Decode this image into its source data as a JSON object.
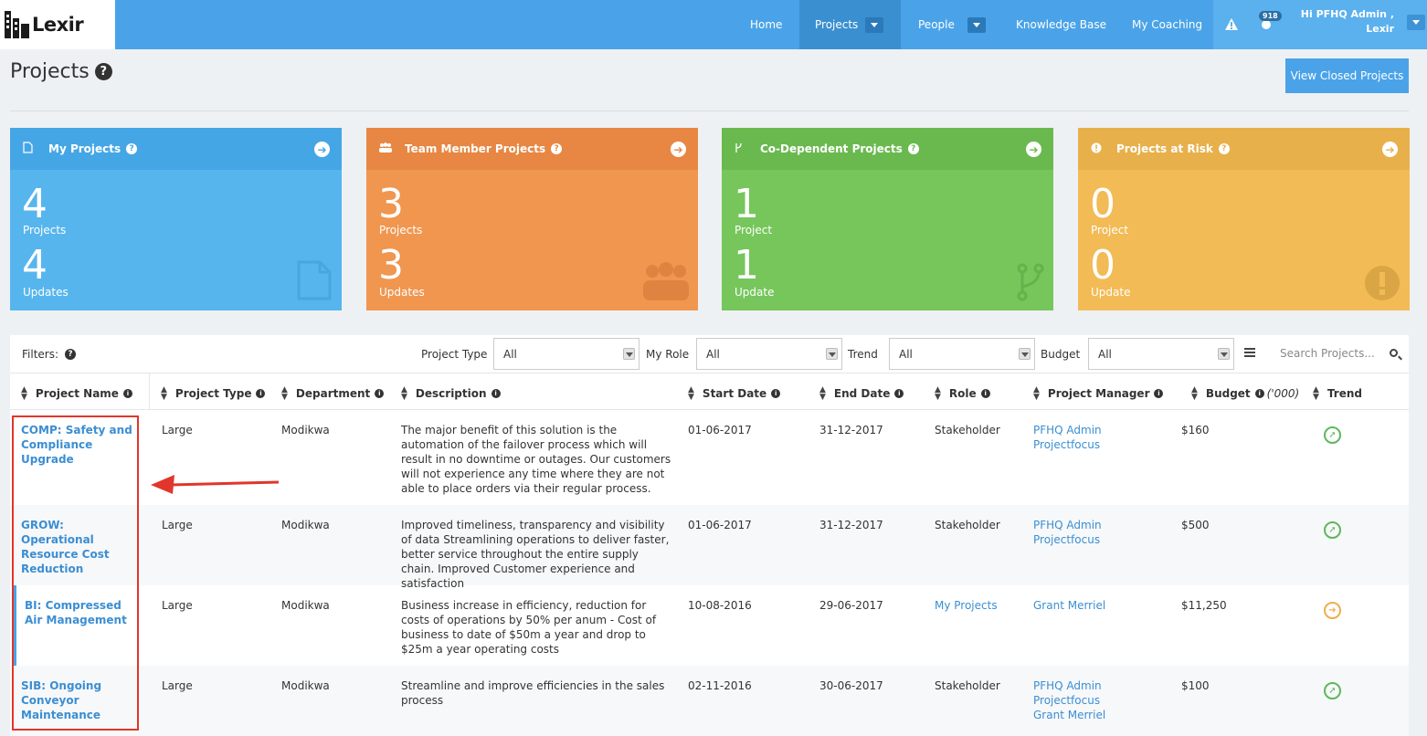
{
  "app": {
    "logo_text": "Lexir"
  },
  "nav": {
    "items": [
      {
        "label": "Home"
      },
      {
        "label": "Projects"
      },
      {
        "label": "People"
      },
      {
        "label": "Knowledge Base"
      },
      {
        "label": "My Coaching"
      }
    ],
    "notification_count": "918",
    "greeting_line1": "Hi PFHQ Admin ,",
    "greeting_line2": "Lexir"
  },
  "page": {
    "title": "Projects",
    "view_closed_button": "View Closed Projects"
  },
  "cards": [
    {
      "title": "My Projects",
      "count1": "4",
      "label1": "Projects",
      "count2": "4",
      "label2": "Updates",
      "color": "#57b5ee",
      "header_color": "#45a6e6"
    },
    {
      "title": "Team Member Projects",
      "count1": "3",
      "label1": "Projects",
      "count2": "3",
      "label2": "Updates",
      "color": "#f0964f",
      "header_color": "#e78743"
    },
    {
      "title": "Co-Dependent Projects",
      "count1": "1",
      "label1": "Project",
      "count2": "1",
      "label2": "Update",
      "color": "#76c65b",
      "header_color": "#6ab94f"
    },
    {
      "title": "Projects at Risk",
      "count1": "0",
      "label1": "Project",
      "count2": "0",
      "label2": "Update",
      "color": "#f2bb55",
      "header_color": "#e8b04b"
    }
  ],
  "filters": {
    "label": "Filters:",
    "project_type_label": "Project Type",
    "project_type_value": "All",
    "my_role_label": "My Role",
    "my_role_value": "All",
    "trend_label": "Trend",
    "trend_value": "All",
    "budget_label": "Budget",
    "budget_value": "All",
    "search_placeholder": "Search Projects..."
  },
  "table": {
    "headers": [
      "Project Name",
      "Project Type",
      "Department",
      "Description",
      "Start Date",
      "End Date",
      "Role",
      "Project Manager",
      "Budget",
      "Trend"
    ],
    "budget_unit": "('000)",
    "rows": [
      {
        "name": "COMP: Safety and Compliance Upgrade",
        "type": "Large",
        "department": "Modikwa",
        "description": "The major benefit of this solution is the automation of the failover process which will result in no downtime or outages. Our customers will not experience any time where they are not able to place orders via their regular process.",
        "start": "01-06-2017",
        "end": "31-12-2017",
        "role": "Stakeholder",
        "managers": [
          "PFHQ Admin",
          "Projectfocus"
        ],
        "budget": "$160",
        "trend": "up"
      },
      {
        "name": "GROW: Operational Resource Cost Reduction",
        "type": "Large",
        "department": "Modikwa",
        "description": "Improved timeliness, transparency and visibility of data Streamlining operations to deliver faster, better service throughout the entire supply chain. Improved Customer experience and satisfaction",
        "start": "01-06-2017",
        "end": "31-12-2017",
        "role": "Stakeholder",
        "managers": [
          "PFHQ Admin",
          "Projectfocus"
        ],
        "budget": "$500",
        "trend": "up"
      },
      {
        "name": "BI: Compressed Air Management",
        "type": "Large",
        "department": "Modikwa",
        "description": "Business increase in efficiency, reduction for costs of operations by 50% per anum - Cost of business to date of $50m a year and drop to $25m a year operating costs",
        "start": "10-08-2016",
        "end": "29-06-2017",
        "role": "My Projects",
        "managers": [
          "Grant Merriel"
        ],
        "budget": "$11,250",
        "trend": "flat"
      },
      {
        "name": "SIB: Ongoing Conveyor Maintenance",
        "type": "Large",
        "department": "Modikwa",
        "description": "Streamline and improve efficiencies in the sales process",
        "start": "02-11-2016",
        "end": "30-06-2017",
        "role": "Stakeholder",
        "managers": [
          "PFHQ Admin",
          "Projectfocus",
          "Grant Merriel"
        ],
        "budget": "$100",
        "trend": "up"
      }
    ]
  },
  "colors": {
    "accent": "#4aa3e8",
    "link": "#3b8ed3",
    "annotation": "#e2352b"
  }
}
